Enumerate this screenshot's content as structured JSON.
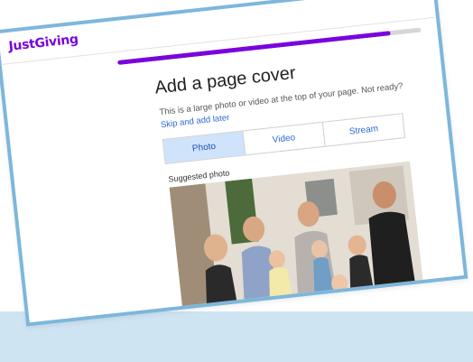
{
  "header": {
    "logo_text": "JustGiving"
  },
  "progress": {
    "fraction": 0.9
  },
  "main": {
    "title": "Add a page cover",
    "subtitle": "This is a large photo or video at the top of your page. Not ready?",
    "skip_link": "Skip and add later",
    "tabs": [
      {
        "label": "Photo",
        "selected": true
      },
      {
        "label": "Video",
        "selected": false
      },
      {
        "label": "Stream",
        "selected": false
      }
    ],
    "suggested_label": "Suggested photo"
  },
  "colors": {
    "brand": "#7a04dd",
    "link": "#2a6ad8",
    "selected_tab": "#cfe3fb",
    "frame_border": "#7db7db"
  }
}
